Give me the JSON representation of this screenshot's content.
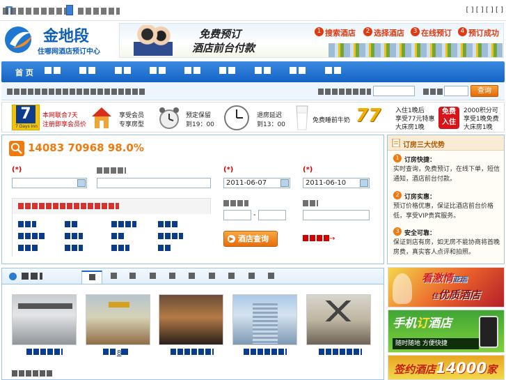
{
  "topbar": {
    "left_text": "",
    "mid_text": "",
    "right_text": "[      ] [      ] [       ] [      ]"
  },
  "logo": {
    "name": "金地段",
    "subtitle": "住哪网酒店预订中心"
  },
  "banner": {
    "slogan_1": "免费预订",
    "slogan_2": "酒店前台付款",
    "steps": [
      "搜索酒店",
      "选择酒店",
      "在线预订",
      "预订成功"
    ],
    "step_nums": [
      "1",
      "2",
      "3",
      "4"
    ]
  },
  "nav": {
    "items": [
      "",
      "",
      "",
      "",
      "",
      "",
      "",
      "",
      "",
      ""
    ]
  },
  "subnav": {
    "left_text": "",
    "kw_label": "",
    "kw_value": "",
    "city_label": "",
    "city_value": "",
    "search_btn": "查询"
  },
  "promo": {
    "seven_days": "7",
    "seven_days_sub": "7 Days Inn",
    "line1a": "本网联合7天",
    "line1b": "注册即享会员价",
    "member1": "享受会员",
    "member2": "专享房型",
    "hold1": "预定保留",
    "hold2": "到19：00",
    "checkout1": "退房延迟",
    "checkout2": "到13：00",
    "milk": "免费睡前牛奶",
    "price_badge": "77",
    "deal1a": "入住1晚后",
    "deal1b": "享受77元特惠",
    "deal1c": "大床房1晚",
    "free_badge_1": "免费",
    "free_badge_2": "入住",
    "deal2a": "2000积分可",
    "deal2b": "享受1晚免费",
    "deal2c": "大床房1晚"
  },
  "search": {
    "stats": "14083 70968 98.0%",
    "city_label": "(*)",
    "city_value": "",
    "keyword_label": "",
    "checkin_label": "(*)",
    "checkin_value": "2011-06-07",
    "checkout_label": "(*)",
    "checkout_value": "2011-06-10",
    "price_label": "",
    "price_sep": "-",
    "brand_label": "",
    "notice": "",
    "more_link": "→",
    "submit": "酒店查询",
    "districts": [
      "",
      "",
      "",
      "",
      "",
      "",
      "",
      "",
      "",
      "",
      "",
      ""
    ]
  },
  "advantages": {
    "title": "订房三大优势",
    "items": [
      {
        "num": "1",
        "title": "订房快捷：",
        "text": "实时查询，免费预订，在线下单，短信通知，酒店前台付款。"
      },
      {
        "num": "2",
        "title": "订房实惠：",
        "text": "预订价格优惠，保证比酒店前台价格低，享受VIP贵宾服务。"
      },
      {
        "num": "3",
        "title": "安全可靠：",
        "text": "保证到店有房，如无房不能协商将首晚房费，真实客人点评和拍照。"
      }
    ]
  },
  "hotels": {
    "title": "",
    "tabs": [
      "",
      "",
      "",
      "",
      "",
      "",
      "",
      "",
      "",
      ""
    ],
    "captions": [
      "",
      "8",
      "",
      "",
      ""
    ],
    "footer": ""
  },
  "ads": {
    "ad1a": "看激情",
    "ad1b": "亚运",
    "ad1c": "住",
    "ad1d": "优质酒店",
    "ad2a": "手机",
    "ad2b": "订",
    "ad2c": "酒店",
    "ad2d": "随时随地",
    "ad2e": "方便快捷",
    "ad3a": "签约酒店",
    "ad3b": "14000",
    "ad3c": "家"
  },
  "colors": {
    "nav": "#1a67c8",
    "accent_orange": "#f07a10",
    "red": "#d40000",
    "box_border": "#9cc3e6"
  }
}
